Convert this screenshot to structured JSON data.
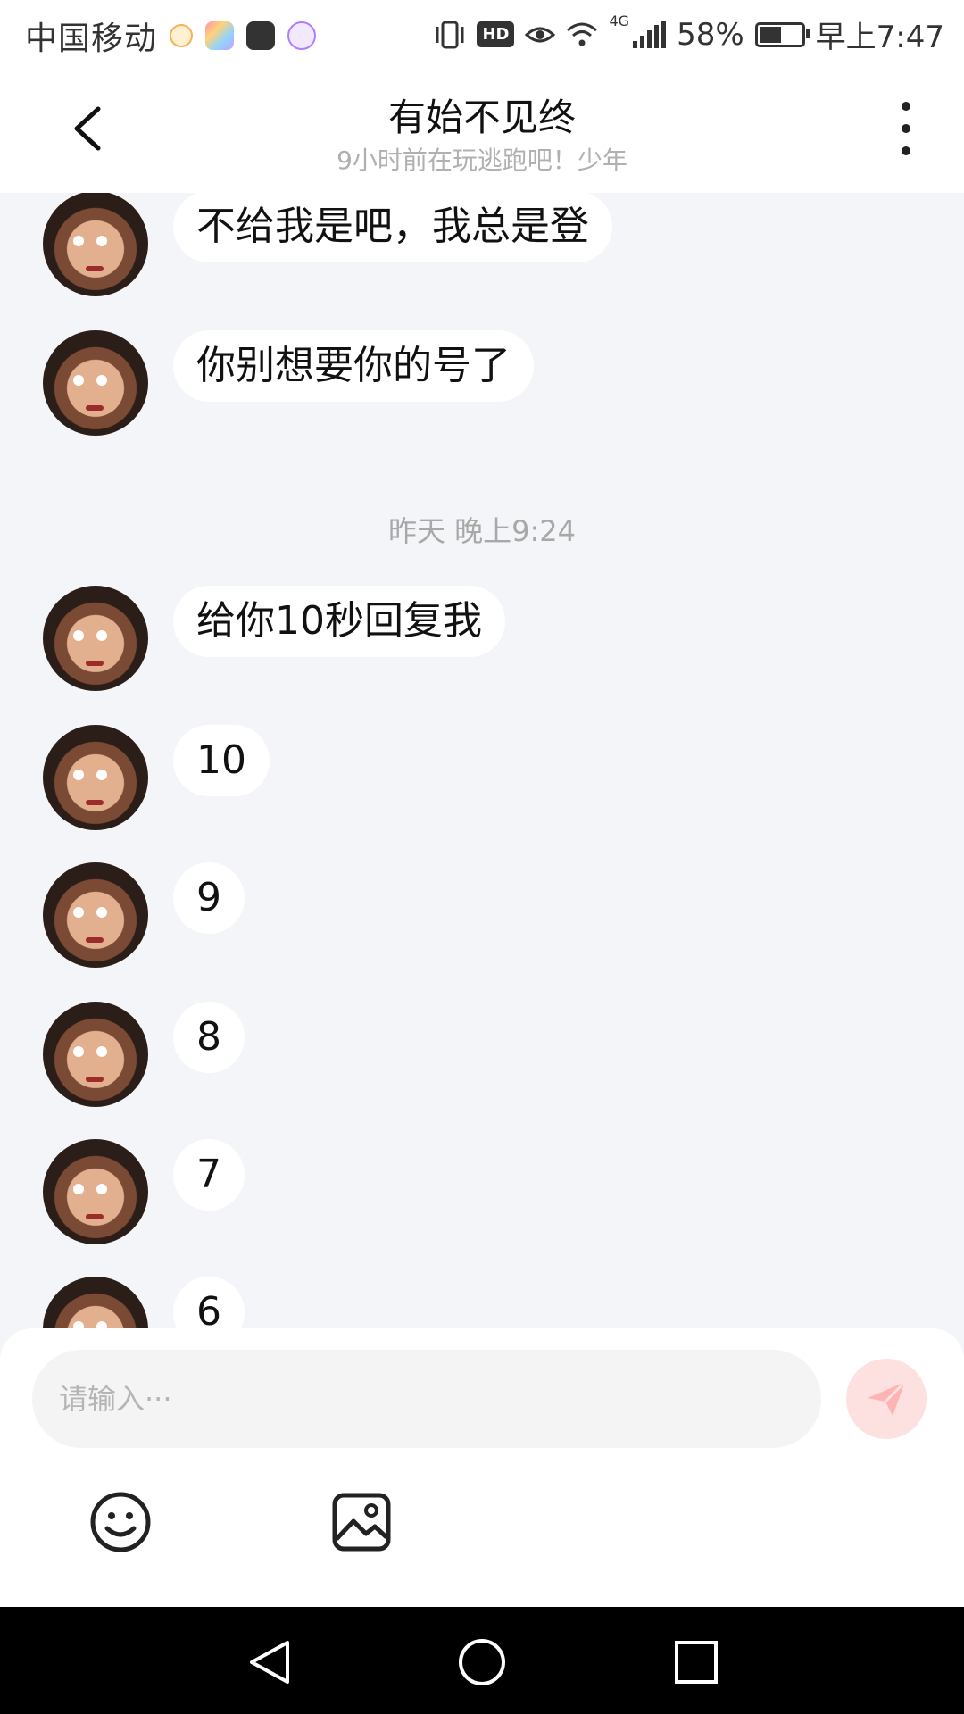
{
  "status_bar": {
    "carrier": "中国移动",
    "hd": "HD",
    "network": "4G",
    "battery_text": "58%",
    "battery_level": 0.58,
    "time": "早上7:47"
  },
  "header": {
    "title": "有始不见终",
    "subtitle": "9小时前在玩逃跑吧！少年"
  },
  "messages": [
    {
      "text": "不给我是吧，我总是登"
    },
    {
      "text": "你别想要你的号了"
    },
    {
      "text": "给你10秒回复我"
    },
    {
      "text": "10"
    },
    {
      "text": "9"
    },
    {
      "text": "8"
    },
    {
      "text": "7"
    },
    {
      "text": "6"
    }
  ],
  "time_separator": "昨天 晚上9:24",
  "input": {
    "placeholder": "请输入···"
  },
  "icons": {
    "back": "chevron-left-icon",
    "more": "more-vertical-icon",
    "send": "paper-plane-icon",
    "emoji": "smiley-icon",
    "image": "image-icon",
    "nav_back": "triangle-back-icon",
    "nav_home": "circle-home-icon",
    "nav_recent": "square-recent-icon"
  },
  "colors": {
    "chat_bg": "#f4f5f8",
    "bubble_bg": "#ffffff",
    "send_button": "#fde0e0",
    "send_icon": "#ffb3b3"
  }
}
